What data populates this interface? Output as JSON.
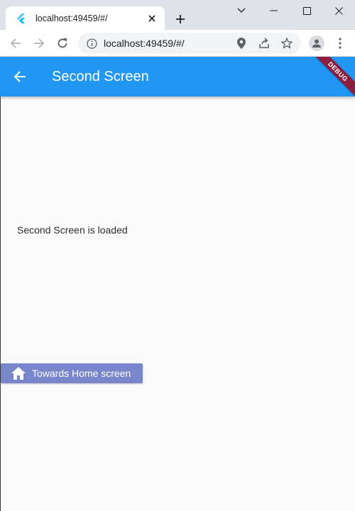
{
  "browser": {
    "tab_title": "localhost:49459/#/",
    "url": "localhost:49459/#/"
  },
  "app": {
    "title": "Second Screen",
    "debug_label": "DEBUG",
    "primary_color": "#2196f3",
    "status_text": "Second Screen is loaded",
    "home_button_label": "Towards Home screen",
    "home_button_color": "#7986cb"
  }
}
